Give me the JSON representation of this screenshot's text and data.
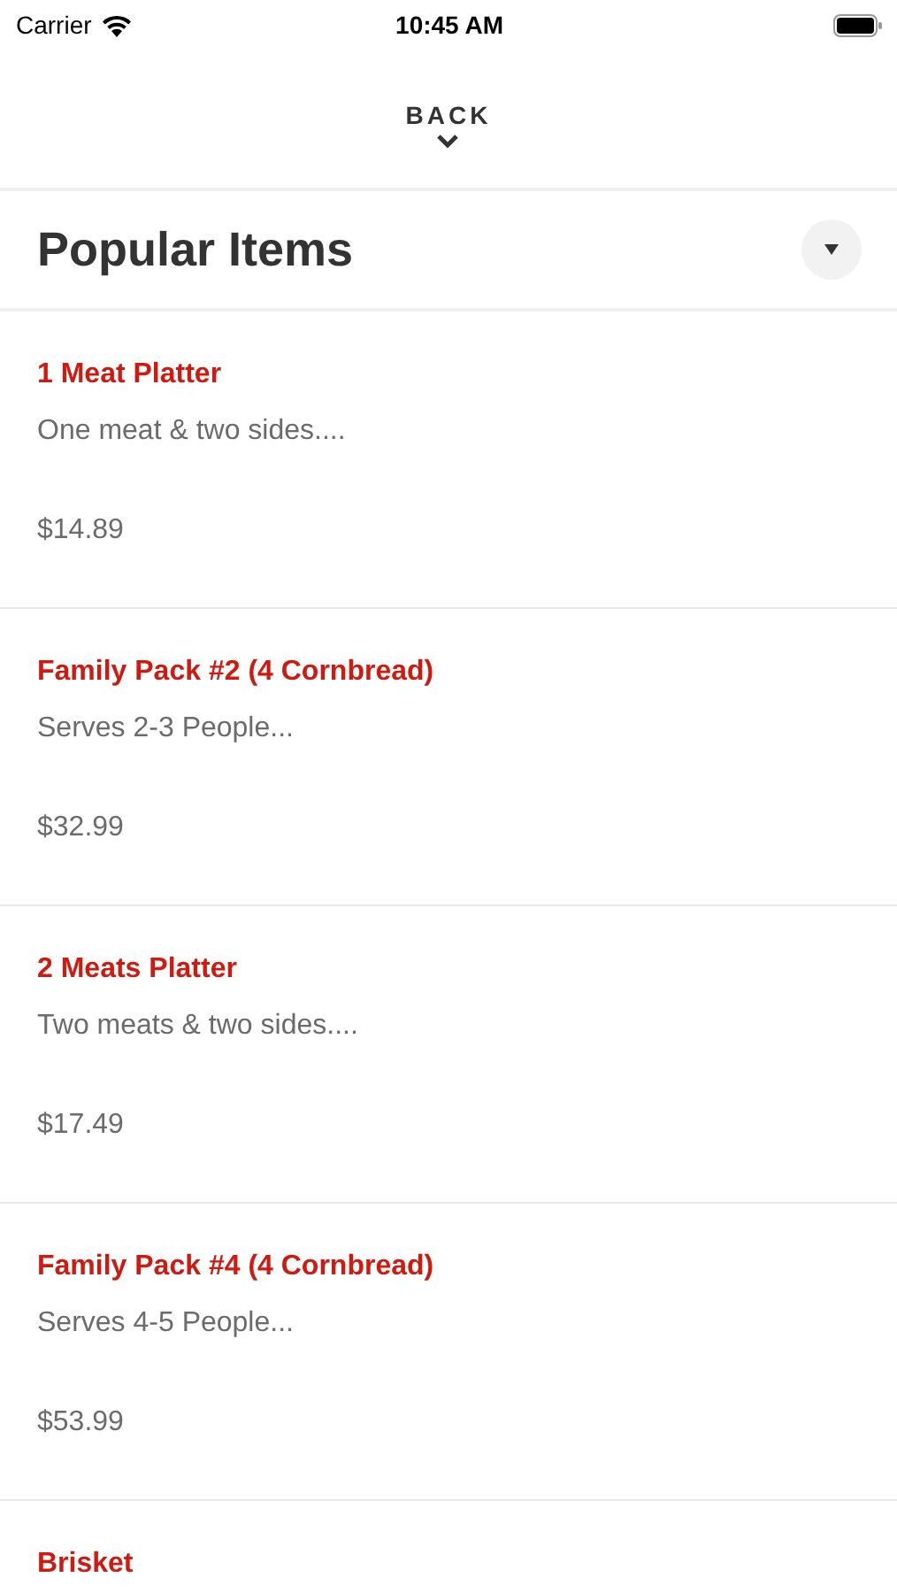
{
  "status_bar": {
    "carrier": "Carrier",
    "time": "10:45 AM"
  },
  "back": {
    "label": "BACK"
  },
  "section": {
    "title": "Popular Items"
  },
  "items": [
    {
      "name": "1 Meat Platter",
      "description": "One meat & two sides....",
      "price": "$14.89"
    },
    {
      "name": "Family Pack #2 (4 Cornbread)",
      "description": "Serves 2-3 People...",
      "price": "$32.99"
    },
    {
      "name": "2 Meats Platter",
      "description": "Two meats & two sides....",
      "price": "$17.49"
    },
    {
      "name": "Family Pack #4 (4 Cornbread)",
      "description": "Serves 4-5 People...",
      "price": "$53.99"
    },
    {
      "name": "Brisket"
    }
  ]
}
